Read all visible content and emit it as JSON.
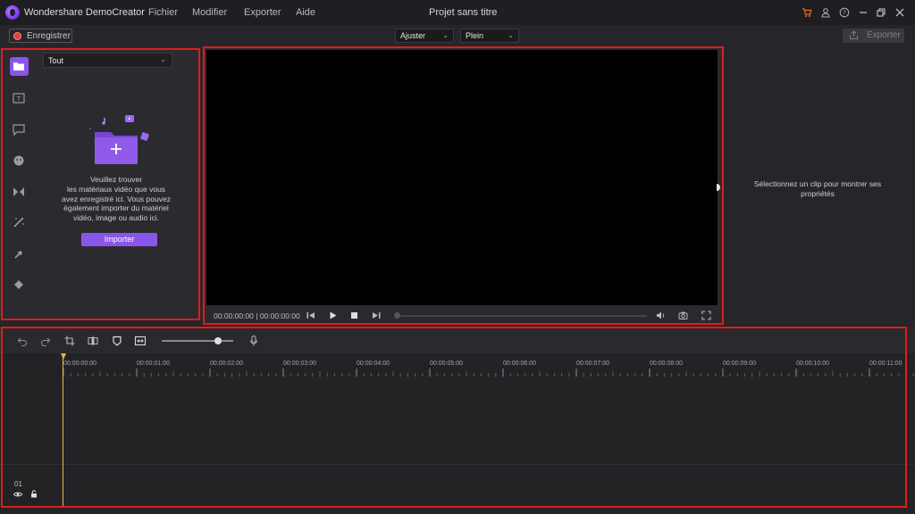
{
  "app": {
    "name": "Wondershare DemoCreator",
    "document_title": "Projet sans titre"
  },
  "menu": [
    {
      "label": "Fichier"
    },
    {
      "label": "Modifier"
    },
    {
      "label": "Exporter"
    },
    {
      "label": "Aide"
    }
  ],
  "titlebar_icons": [
    "cart-icon",
    "account-icon",
    "help-icon",
    "minimize-icon",
    "restore-icon",
    "close-icon"
  ],
  "toolbar": {
    "record_label": "Enregistrer",
    "fit_select": "Ajuster",
    "quality_select": "Plein",
    "export_label": "Exporter"
  },
  "media": {
    "filter": "Tout",
    "message_lines": [
      "Veuillez trouver",
      "les matériaux vidéo que vous",
      "avez enregistré ici. Vous pouvez",
      "également importer du matériel",
      "vidéo, image ou audio ici."
    ],
    "import_label": "Importer",
    "rail_icons": [
      "media-library-icon",
      "text-icon",
      "annotation-icon",
      "sticker-icon",
      "transition-icon",
      "effects-icon",
      "cursor-effects-icon",
      "audio-icon"
    ]
  },
  "preview": {
    "timecode": "00:00:00:00 | 00:00:00:00"
  },
  "properties": {
    "message": "Sélectionnez un clip pour montrer ses propriétés"
  },
  "timeline": {
    "ruler_labels": [
      "00:00:00:00",
      "00:00:01:00",
      "00:00:02:00",
      "00:00:03:00",
      "00:00:04:00",
      "00:00:05:00",
      "00:00:06:00",
      "00:00:07:00",
      "00:00:08:00",
      "00:00:09:00",
      "00:00:10:00",
      "00:00:11:00"
    ],
    "track_number": "01",
    "tools": [
      "undo-icon",
      "redo-icon",
      "crop-icon",
      "split-icon",
      "marker-icon",
      "fit-timeline-icon",
      "microphone-icon"
    ]
  },
  "colors": {
    "accent": "#8a55e8",
    "record": "#e0403a",
    "playhead": "#e8b24a",
    "highlight": "#e21b1b"
  }
}
